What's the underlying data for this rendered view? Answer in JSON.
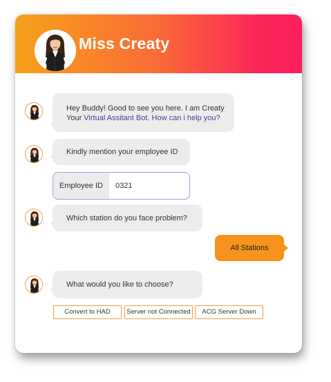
{
  "header": {
    "title": "Miss Creaty"
  },
  "messages": {
    "greeting_line1": "Hey Buddy! Good to see you here. I am Creaty",
    "greeting_line2_prefix": "Your ",
    "greeting_line2_accent": "Virtual Assitant Bot. How can i help you?",
    "ask_employee_id": "Kindly mention your employee ID",
    "ask_station": "Which station do you face problem?",
    "ask_choice": "What would you like to choose?"
  },
  "employee": {
    "label": "Employee ID",
    "value": "0321"
  },
  "user_reply": "All Stations",
  "options": [
    "Convert to HAD",
    "Server not Connected",
    "ACG Server Down"
  ],
  "colors": {
    "header_gradient_start": "#f7a21a",
    "header_gradient_end": "#fc1f5c",
    "bubble_bot": "#ececec",
    "bubble_user": "#f7921e",
    "accent_text": "#4a3f8c",
    "option_border": "#f39c3c",
    "input_border": "#a49fd8"
  }
}
